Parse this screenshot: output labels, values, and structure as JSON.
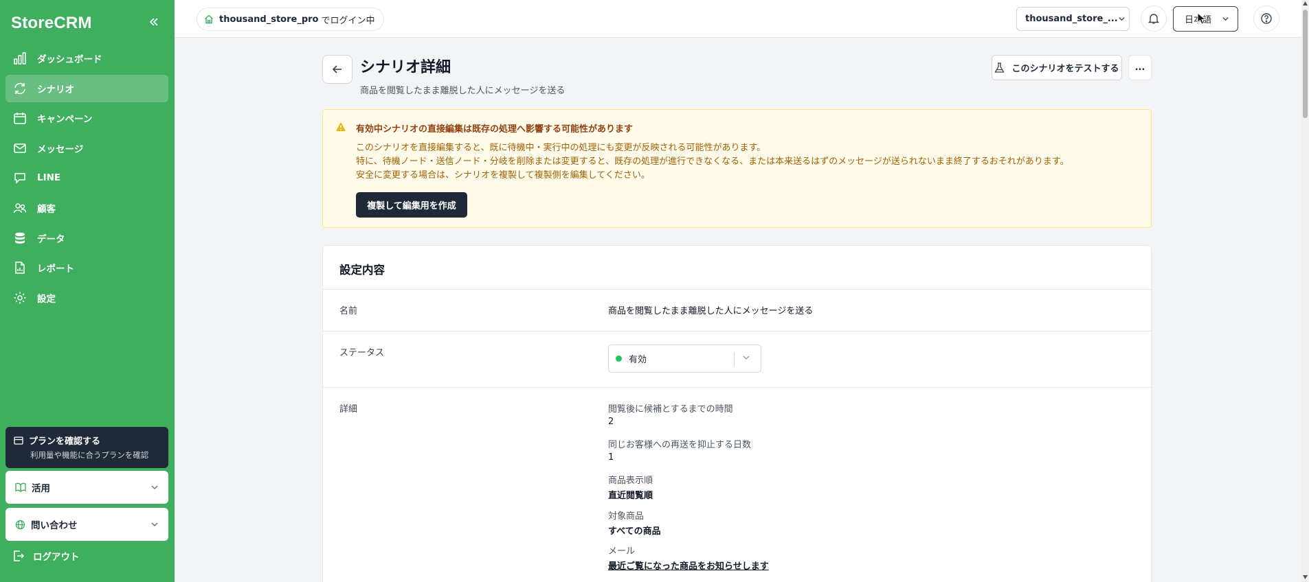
{
  "sidebar": {
    "brand": "StoreCRM",
    "items": [
      {
        "label": "ダッシュボード",
        "icon": "bar-chart-icon"
      },
      {
        "label": "シナリオ",
        "icon": "refresh-icon",
        "active": true
      },
      {
        "label": "キャンペーン",
        "icon": "calendar-icon"
      },
      {
        "label": "メッセージ",
        "icon": "mail-icon"
      },
      {
        "label": "LINE",
        "icon": "chat-icon"
      },
      {
        "label": "顧客",
        "icon": "users-icon"
      },
      {
        "label": "データ",
        "icon": "database-icon"
      },
      {
        "label": "レポート",
        "icon": "document-icon"
      },
      {
        "label": "設定",
        "icon": "gear-icon"
      }
    ],
    "plan": {
      "title": "プランを確認する",
      "subtitle": "利用量や機能に合うプランを確認"
    },
    "usage": "活用",
    "contact": "問い合わせ",
    "logout": "ログアウト"
  },
  "topbar": {
    "login_user": "thousand_store_pro",
    "login_suffix": "でログイン中",
    "store": "thousand_store_...",
    "language": "日本語"
  },
  "page": {
    "title": "シナリオ詳細",
    "subtitle": "商品を閲覧したまま離脱した人にメッセージを送る",
    "test_button": "このシナリオをテストする",
    "more_button": "..."
  },
  "warning": {
    "title": "有効中シナリオの直接編集は既存の処理へ影響する可能性があります",
    "lines": [
      "このシナリオを直接編集すると、既に待機中・実行中の処理にも変更が反映される可能性があります。",
      "特に、待機ノード・送信ノード・分岐を削除または変更すると、既存の処理が進行できなくなる、または本来送るはずのメッセージが送られないまま終了するおそれがあります。",
      "安全に変更する場合は、シナリオを複製して複製側を編集してください。"
    ],
    "button": "複製して編集用を作成"
  },
  "settings": {
    "title": "設定内容",
    "name_label": "名前",
    "name_value": "商品を閲覧したまま離脱した人にメッセージを送る",
    "status_label": "ステータス",
    "status_value": "有効",
    "status_color": "#22c55e",
    "detail_label": "詳細",
    "details": [
      {
        "label": "閲覧後に候補とするまでの時間",
        "value": "2",
        "style": "plain"
      },
      {
        "label": "同じお客様への再送を抑止する日数",
        "value": "1",
        "style": "plain"
      },
      {
        "label": "商品表示順",
        "value": "直近閲覧順",
        "style": "bold"
      },
      {
        "label": "対象商品",
        "value": "すべての商品",
        "style": "bold"
      },
      {
        "label": "メール",
        "value": "最近ご覧になった商品をお知らせします",
        "style": "link"
      }
    ]
  },
  "colors": {
    "sidebar": "#3fae5f",
    "accent_dark": "#1f2937",
    "warning_bg": "#fefbea"
  }
}
